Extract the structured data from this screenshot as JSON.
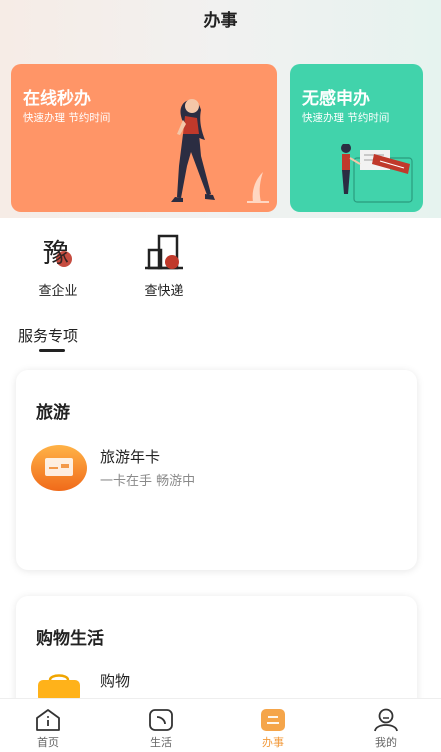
{
  "header": {
    "title": "办事"
  },
  "banners": [
    {
      "title": "在线秒办",
      "subtitle": "快速办理 节约时间",
      "color": "#ff9567"
    },
    {
      "title": "无感申办",
      "subtitle": "快速办理 节约时间",
      "color": "#41d3ab"
    }
  ],
  "quick_links": [
    {
      "label": "查企业",
      "icon": "enterprise-icon"
    },
    {
      "label": "查快递",
      "icon": "express-icon"
    }
  ],
  "section": {
    "title": "服务专项"
  },
  "cards": [
    {
      "title": "旅游",
      "items": [
        {
          "title": "旅游年卡",
          "subtitle": "一卡在手 畅游中",
          "icon": "card-icon"
        }
      ]
    },
    {
      "title": "购物生活",
      "items": [
        {
          "title": "购物",
          "icon": "shopping-bag-icon"
        }
      ]
    }
  ],
  "tabbar": {
    "tabs": [
      {
        "label": "首页",
        "icon": "home-icon",
        "active": false
      },
      {
        "label": "生活",
        "icon": "life-icon",
        "active": false
      },
      {
        "label": "办事",
        "icon": "service-icon",
        "active": true
      },
      {
        "label": "我的",
        "icon": "profile-icon",
        "active": false
      }
    ],
    "active_color": "#f29a3b"
  }
}
